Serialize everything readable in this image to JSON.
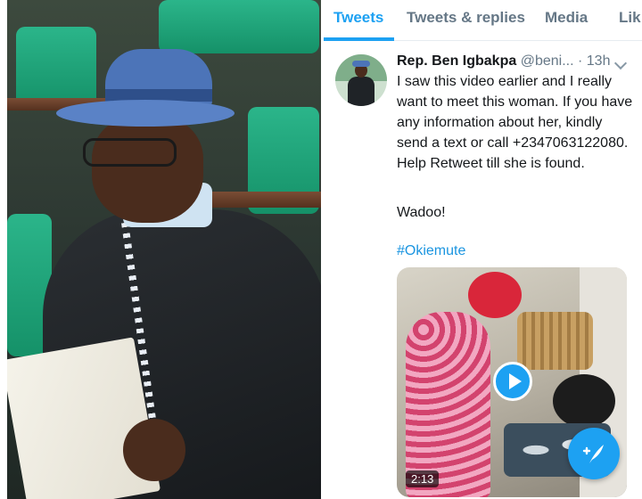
{
  "tabs": [
    {
      "label": "Tweets",
      "active": true
    },
    {
      "label": "Tweets & replies",
      "active": false
    },
    {
      "label": "Media",
      "active": false
    },
    {
      "label": "Lik",
      "active": false
    }
  ],
  "tweet": {
    "author_name": "Rep. Ben Igbakpa",
    "author_handle": "@beni...",
    "separator": "·",
    "time": "13h",
    "text": "I saw this video earlier and I really want to meet this woman. If you have any information about her, kindly send a text or call +2347063122080. Help Retweet till she is found.",
    "text2": "Wadoo!",
    "hashtag": "#Okiemute",
    "video_duration": "2:13"
  },
  "icons": {
    "chevron": "chevron-down-icon",
    "play": "play-icon",
    "compose": "compose-tweet-icon"
  },
  "colors": {
    "accent": "#1da1f2",
    "hashtag": "#1b95e0",
    "secondary_text": "#657786"
  }
}
